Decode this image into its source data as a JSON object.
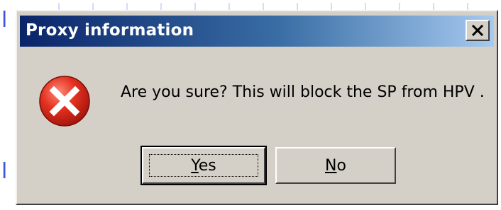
{
  "dialog": {
    "title": "Proxy information",
    "message": "Are you sure? This will block the SP from HPV .",
    "icon": "error-icon",
    "buttons": {
      "yes_label": "Yes",
      "no_label": "No"
    },
    "close_icon": "close-icon"
  },
  "colors": {
    "titlebar_start": "#0a246a",
    "titlebar_end": "#a6caf0",
    "dialog_face": "#d4d0c8",
    "error_red": "#d8261b"
  }
}
